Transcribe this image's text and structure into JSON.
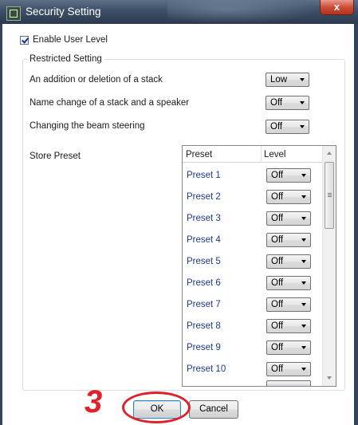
{
  "window": {
    "title": "Security Setting",
    "close_glyph": "x",
    "icon": "app-icon"
  },
  "enable_user_level": {
    "label": "Enable User Level",
    "checked": true
  },
  "restricted": {
    "legend": "Restricted Setting",
    "settings": [
      {
        "label": "An addition or deletion of a stack",
        "value": "Low"
      },
      {
        "label": "Name change of a stack and a speaker",
        "value": "Off"
      },
      {
        "label": "Changing the beam steering",
        "value": "Off"
      }
    ],
    "store_preset_label": "Store Preset"
  },
  "preset_list": {
    "headers": [
      "Preset",
      "Level"
    ],
    "rows": [
      {
        "name": "Preset 1",
        "level": "Off"
      },
      {
        "name": "Preset 2",
        "level": "Off"
      },
      {
        "name": "Preset 3",
        "level": "Off"
      },
      {
        "name": "Preset 4",
        "level": "Off"
      },
      {
        "name": "Preset 5",
        "level": "Off"
      },
      {
        "name": "Preset 6",
        "level": "Off"
      },
      {
        "name": "Preset 7",
        "level": "Off"
      },
      {
        "name": "Preset 8",
        "level": "Off"
      },
      {
        "name": "Preset 9",
        "level": "Off"
      },
      {
        "name": "Preset 10",
        "level": "Off"
      }
    ]
  },
  "buttons": {
    "ok": "OK",
    "cancel": "Cancel"
  },
  "annotation": {
    "step": "3",
    "color": "#e0202a"
  },
  "colors": {
    "titlebar": "#3d4f66",
    "close": "#cc4d37",
    "preset_text": "#1f3a8a"
  }
}
